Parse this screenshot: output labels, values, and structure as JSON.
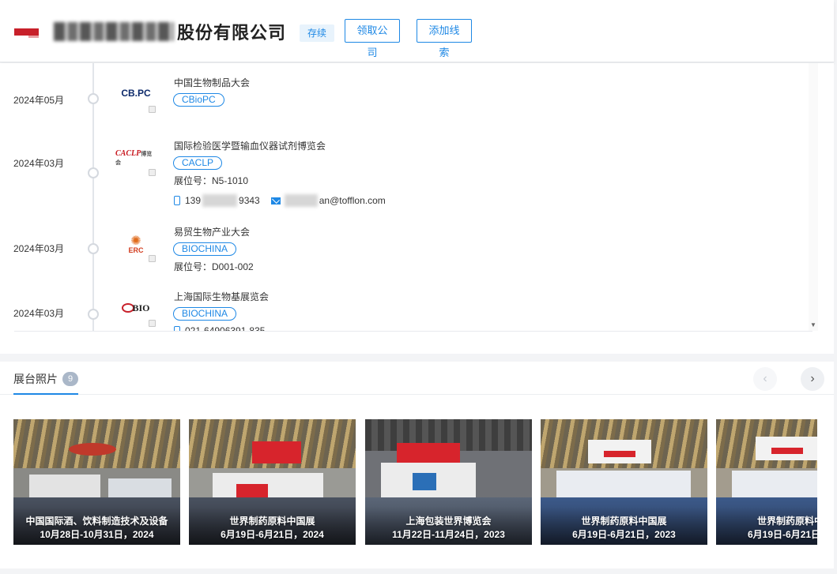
{
  "header": {
    "company_name_visible": "股份有限公司",
    "status": "存续",
    "claim_button": "领取公司",
    "add_lead_button": "添加线索"
  },
  "exhibitions": [
    {
      "date": "2024年05月",
      "logo_text": "CB.PC",
      "name": "中国生物制品大会",
      "tag": "CBioPC"
    },
    {
      "date": "2024年03月",
      "logo_text": "CACLP",
      "logo_sub": "博览会",
      "name": "国际检验医学暨输血仪器试剂博览会",
      "tag": "CACLP",
      "booth": "展位号：N5-1010",
      "phone_prefix": "139",
      "phone_suffix": "9343",
      "email_suffix": "an@tofflon.com"
    },
    {
      "date": "2024年03月",
      "logo_text": "ERC",
      "name": "易贸生物产业大会",
      "tag": "BIOCHINA",
      "booth": "展位号：D001-002"
    },
    {
      "date": "2024年03月",
      "logo_text": "BIO",
      "name": "上海国际生物基展览会",
      "tag": "BIOCHINA",
      "phone_partial": "021-64906391-835"
    }
  ],
  "photos": {
    "title": "展台照片",
    "count": "9",
    "prev_icon": "chevron-left-icon",
    "next_icon": "chevron-right-icon",
    "items": [
      {
        "caption": "中国国际酒、饮料制造技术及设备",
        "dates": "10月28日-10月31日，2024"
      },
      {
        "caption": "世界制药原料中国展",
        "dates": "6月19日-6月21日，2024"
      },
      {
        "caption": "上海包装世界博览会",
        "dates": "11月22日-11月24日，2023"
      },
      {
        "caption": "世界制药原料中国展",
        "dates": "6月19日-6月21日，2023"
      },
      {
        "caption": "世界制药原料中",
        "dates": "6月19日-6月21日"
      }
    ]
  },
  "colors": {
    "accent": "#1e88e5",
    "brand_red": "#c8202a"
  }
}
